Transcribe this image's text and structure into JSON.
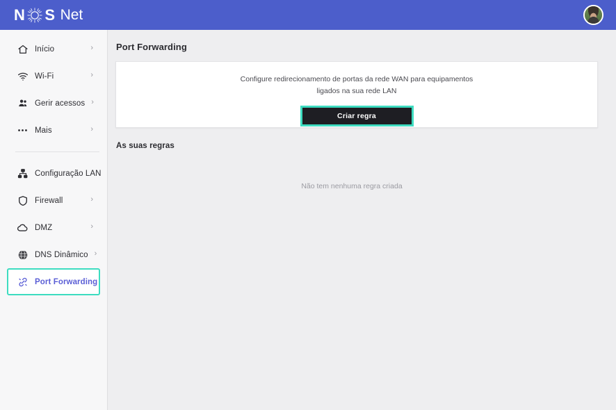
{
  "header": {
    "brand": {
      "part1": "N",
      "logo_icon": "nos-sunburst-circle-icon",
      "part2": "S",
      "suffix": "Net"
    },
    "avatar_name": "user-avatar",
    "background_color": "#4c5ecb"
  },
  "sidebar": {
    "background_color": "#f7f7f8",
    "active_border_color": "#3ddcc0",
    "active_text_color": "#5b5fd6",
    "chevron": "›",
    "groups": [
      {
        "items": [
          {
            "label": "Início",
            "icon": "home-icon",
            "chevron": true,
            "active": false
          },
          {
            "label": "Wi-Fi",
            "icon": "wifi-icon",
            "chevron": true,
            "active": false
          },
          {
            "label": "Gerir acessos",
            "icon": "users-icon",
            "chevron": true,
            "active": false
          },
          {
            "label": "Mais",
            "icon": "ellipsis-icon",
            "chevron": true,
            "active": false
          }
        ]
      },
      {
        "items": [
          {
            "label": "Configuração LAN",
            "icon": "sitemap-icon",
            "chevron": true,
            "active": false
          },
          {
            "label": "Firewall",
            "icon": "shield-icon",
            "chevron": true,
            "active": false
          },
          {
            "label": "DMZ",
            "icon": "cloud-icon",
            "chevron": true,
            "active": false
          },
          {
            "label": "DNS Dinâmico",
            "icon": "globe-icon",
            "chevron": true,
            "active": false
          },
          {
            "label": "Port Forwarding",
            "icon": "link-chain-icon",
            "chevron": false,
            "active": true
          }
        ]
      }
    ]
  },
  "main": {
    "page_title": "Port Forwarding",
    "card": {
      "description": "Configure redirecionamento de portas da rede WAN para equipamentos ligados na sua rede LAN",
      "button_label": "Criar regra",
      "button_bg": "#1e1e23",
      "button_highlight": "#3ddcc0"
    },
    "rules_section": {
      "title": "As suas regras",
      "empty_message": "Não tem nenhuma regra criada"
    }
  }
}
